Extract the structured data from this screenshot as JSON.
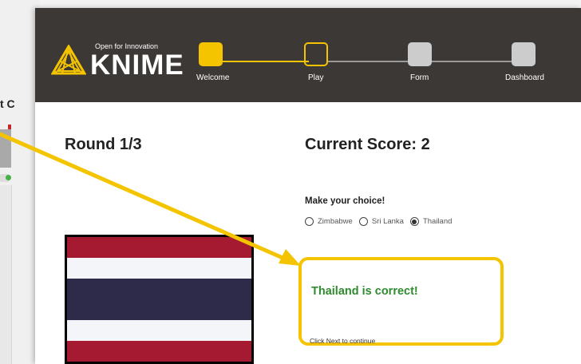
{
  "left_panel": {
    "partial_label": "t C"
  },
  "header": {
    "tagline": "Open for Innovation",
    "brand": "KNIME",
    "steps": [
      {
        "label": "Welcome",
        "state": "completed"
      },
      {
        "label": "Play",
        "state": "active"
      },
      {
        "label": "Form",
        "state": "inactive"
      },
      {
        "label": "Dashboard",
        "state": "inactive"
      }
    ]
  },
  "game": {
    "round": "Round 1/3",
    "score": "Current Score: 2",
    "choice_prompt": "Make your choice!",
    "options": [
      "Zimbabwe",
      "Sri Lanka",
      "Thailand"
    ],
    "selected": "Thailand",
    "result": "Thailand is correct!",
    "continue_hint": "Click Next to continue"
  },
  "flag": {
    "country": "Thailand",
    "stripes": [
      "#a51931",
      "#f4f5f8",
      "#2d2a4a",
      "#f4f5f8",
      "#a51931"
    ]
  },
  "colors": {
    "header_bg": "#3c3836",
    "accent_yellow": "#f5c400",
    "step_inactive": "#cccccc",
    "correct_green": "#2e8b2e"
  }
}
